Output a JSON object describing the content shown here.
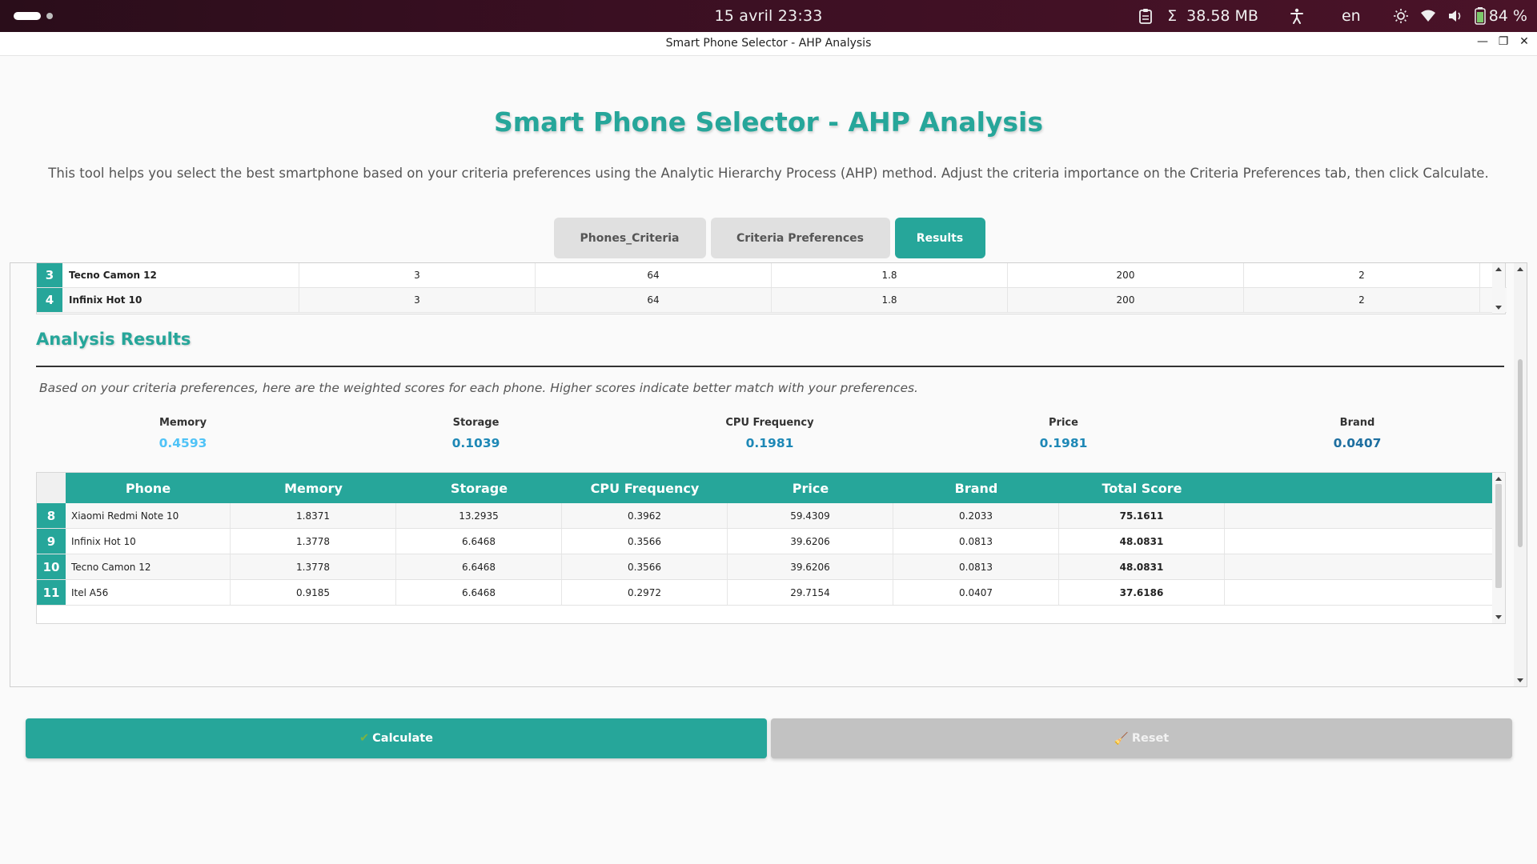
{
  "system_bar": {
    "clock": "15 avril  23:33",
    "memory": "38.58 MB",
    "sigma": "Σ",
    "language": "en",
    "battery": "84 %"
  },
  "window": {
    "title": "Smart Phone Selector - AHP Analysis"
  },
  "app": {
    "heading": "Smart Phone Selector - AHP Analysis",
    "description": "This tool helps you select the best smartphone based on your criteria preferences using the Analytic Hierarchy Process (AHP) method. Adjust the criteria importance on the Criteria Preferences tab, then click Calculate.",
    "tabs": [
      {
        "label": "Phones_Criteria",
        "active": false
      },
      {
        "label": "Criteria Preferences",
        "active": false
      },
      {
        "label": "Results",
        "active": true
      }
    ]
  },
  "phones_table": {
    "rows": [
      {
        "index": "3",
        "name": "Tecno Camon 12",
        "memory": "3",
        "storage": "64",
        "cpu": "1.8",
        "price": "200",
        "brand": "2"
      },
      {
        "index": "4",
        "name": "Infinix Hot 10",
        "memory": "3",
        "storage": "64",
        "cpu": "1.8",
        "price": "200",
        "brand": "2"
      }
    ]
  },
  "analysis": {
    "title": "Analysis Results",
    "description": "Based on your criteria preferences, here are the weighted scores for each phone. Higher scores indicate better match with your preferences.",
    "weights": [
      {
        "label": "Memory",
        "value": "0.4593",
        "color": "#4fc3f7"
      },
      {
        "label": "Storage",
        "value": "0.1039",
        "color": "#1e88b6"
      },
      {
        "label": "CPU Frequency",
        "value": "0.1981",
        "color": "#1e88b6"
      },
      {
        "label": "Price",
        "value": "0.1981",
        "color": "#1e88b6"
      },
      {
        "label": "Brand",
        "value": "0.0407",
        "color": "#1e6fa0"
      }
    ]
  },
  "results_table": {
    "headers": [
      "Phone",
      "Memory",
      "Storage",
      "CPU Frequency",
      "Price",
      "Brand",
      "Total Score"
    ],
    "rows": [
      {
        "index": "8",
        "phone": "Xiaomi Redmi Note 10",
        "memory": "1.8371",
        "storage": "13.2935",
        "cpu": "0.3962",
        "price": "59.4309",
        "brand": "0.2033",
        "total": "75.1611"
      },
      {
        "index": "9",
        "phone": "Infinix Hot 10",
        "memory": "1.3778",
        "storage": "6.6468",
        "cpu": "0.3566",
        "price": "39.6206",
        "brand": "0.0813",
        "total": "48.0831"
      },
      {
        "index": "10",
        "phone": "Tecno Camon 12",
        "memory": "1.3778",
        "storage": "6.6468",
        "cpu": "0.3566",
        "price": "39.6206",
        "brand": "0.0813",
        "total": "48.0831"
      },
      {
        "index": "11",
        "phone": "Itel A56",
        "memory": "0.9185",
        "storage": "6.6468",
        "cpu": "0.2972",
        "price": "29.7154",
        "brand": "0.0407",
        "total": "37.6186"
      }
    ]
  },
  "buttons": {
    "calculate": "Calculate",
    "calculate_icon": "✔",
    "reset": "Reset",
    "reset_icon": "🧹"
  },
  "colors": {
    "accent": "#26a69a"
  }
}
